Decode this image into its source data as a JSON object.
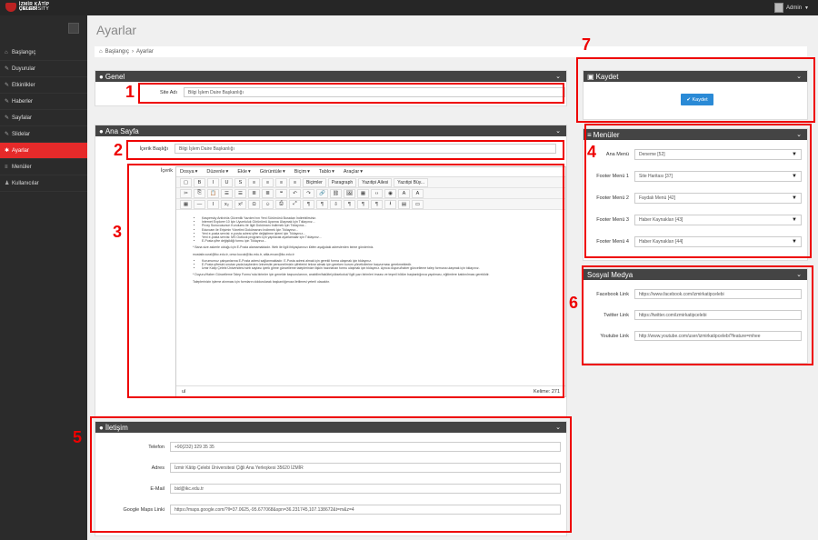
{
  "brand": {
    "line1": "İZMİR KÂTİP ÇELEBİ",
    "line2": "UNIVERSITY"
  },
  "user": {
    "name": "Admin"
  },
  "sidebar": {
    "items": [
      {
        "icon": "home-icon",
        "label": "Başlangıç"
      },
      {
        "icon": "edit-icon",
        "label": "Duyurular"
      },
      {
        "icon": "edit-icon",
        "label": "Etkinlikler"
      },
      {
        "icon": "edit-icon",
        "label": "Haberler"
      },
      {
        "icon": "edit-icon",
        "label": "Sayfalar"
      },
      {
        "icon": "edit-icon",
        "label": "Slidelar"
      },
      {
        "icon": "gear-icon",
        "label": "Ayarlar"
      },
      {
        "icon": "list-icon",
        "label": "Menüler"
      },
      {
        "icon": "user-icon",
        "label": "Kullanıcılar"
      }
    ],
    "active_index": 6
  },
  "page": {
    "title": "Ayarlar",
    "breadcrumb": [
      "Başlangıç",
      "Ayarlar"
    ]
  },
  "genel": {
    "title": "Genel",
    "site_adi_label": "Site Adı",
    "site_adi_value": "Bilgi İşlem Daire Başkanlığı"
  },
  "ana_sayfa": {
    "title": "Ana Sayfa",
    "icerik_basligi_label": "İçerik Başlığı",
    "icerik_basligi_value": "Bilgi İşlem Daire Başkanlığı",
    "icerik_label": "İçerik",
    "editor": {
      "menus": [
        "Dosya",
        "Düzenle",
        "Ekle",
        "Görüntüle",
        "Biçim",
        "Tablo",
        "Araçlar"
      ],
      "toolbar1": [
        "▢",
        "B",
        "I",
        "U",
        "S",
        "≡",
        "≡",
        "≡",
        "≡"
      ],
      "dropdowns1": [
        "Biçimler",
        "Paragraph",
        "Yazıtipi Ailesi",
        "Yazıtipi Büy..."
      ],
      "toolbar2": [
        "✂",
        "⎘",
        "📋",
        "☰",
        "☰",
        "≣",
        "≣",
        "❝",
        "↶",
        "↷",
        "🔗",
        "⛓",
        "🖼",
        "▦",
        "‹›",
        "◉",
        "A",
        "A"
      ],
      "toolbar3": [
        "▦",
        "—",
        "Ⅰ",
        "x₂",
        "x²",
        "Ω",
        "☺",
        "⎙",
        "⤢",
        "¶",
        "¶",
        "⇩",
        "¶",
        "¶",
        "¶",
        "⭳",
        "▤",
        "▭"
      ],
      "body": {
        "list1": [
          "Kaspersky Antivirüs Güvenlik Yazılımı'nın Yeni Sürümünü Buradan İndirebilirsiniz.",
          "İnternet Explorer 10 İçin Uyumluluk Görünümü Ayarına Ulaşmak İçin Tıklayınız...",
          "Proxy Sunucusunun Kurulumu ile İlgili Dokümanı İndirmek İçin Tıklayınız...",
          "Eduroam ile Erişimin Yönetimi Dokümanını İndirmek İçin Tıklayınız...",
          "Yeni e-posta servisi: e-posta adresi şifre değiştirme işlemi için Tıklayınız...",
          "Yeni e-posta servisi: MS Outlook programı için yapılacak ayarlamalar için Tıklayınız...",
          "E-Posta şifre değişikliği formu için Tıklayınız..."
        ],
        "para1": "* Bana size askerle olduğu için E-Posta alamamaktadır. Web ile ilgili ihtiyaçlarınızı lütfen aşağıdaki adreslerden birine gönderiniz.",
        "para2": "mustafa.vural@ikc.edu.tr, omur.kucuk@ikc.edu.tr, atila.ercan@ikc.edu.tr",
        "list2": [
          "Kurumumuz çalışanlarına E-Posta adresi sağlanmaktadır. E-Posta adresi almak için gerekli forma ulaşmak için tıklayınız.",
          "E-Posta şifresini unutan yada kaybeden üniversite personelimizin şifrelerini tekrar almak için gereken kurum yöneticilerine başvurması gerekmektedir.",
          "İzmir Kâtip Çelebi Üniversitesi web sayfası içerik girme güncelleme taleplerinize ilişkin hazırlanan formu ulaşmak için tıklayınız. Ayrıca duyuru/haber güncelleme talep formuna ulaşmak için tıklayınız."
        ],
        "para3": "* Duyuru/Haber Güncelleme Talep Formu'nda birimler için genelde başvurularının, anabilim/fakülte/yüksekokul/ ilgili yazı birimleri imzası ve teşmil bölüm başkanlığınca yapılması, eğitimlere katılınılması gereklidir.",
        "para4": "Taleplerinizin işleme alınması için formların doldurularak başkanlığımıza iletilmesi yeterli olacaktır."
      },
      "path": "ul",
      "word_count": "Kelime: 271"
    }
  },
  "iletisim": {
    "title": "İletişim",
    "fields": [
      {
        "label": "Telefon",
        "value": "+90(232) 329 35 35"
      },
      {
        "label": "Adres",
        "value": "İzmir Kâtip Çelebi Üniversitesi Çiğli Ana Yerleşkesi 35620 İZMİR"
      },
      {
        "label": "E-Mail",
        "value": "bid@ikc.edu.tr"
      },
      {
        "label": "Google Maps Linki",
        "value": "https://maps.google.com/?ll=37.0625,-95.677068&spn=36.231745,107.138672&t=m&z=4"
      }
    ]
  },
  "kaydet": {
    "title": "Kaydet",
    "button": "Kaydet"
  },
  "menuler": {
    "title": "Menüler",
    "fields": [
      {
        "label": "Ana Menü",
        "value": "Deneme [52]"
      },
      {
        "label": "Footer Menü 1",
        "value": "Site Haritası [37]"
      },
      {
        "label": "Footer Menü 2",
        "value": "Faydalı Menü [42]"
      },
      {
        "label": "Footer Menü 3",
        "value": "Haber Kaynakları [43]"
      },
      {
        "label": "Footer Menü 4",
        "value": "Haber Kaynakları [44]"
      }
    ]
  },
  "sosyal": {
    "title": "Sosyal Medya",
    "fields": [
      {
        "label": "Facebook Link",
        "value": "https://www.facebook.com/izmirkatipcelebi"
      },
      {
        "label": "Twitter Link",
        "value": "https://twitter.com/izmirkatipcelebi"
      },
      {
        "label": "Youtube Link",
        "value": "http://www.youtube.com/user/izmirkatipcelebi?feature=mhee"
      }
    ]
  },
  "annotations": [
    "1",
    "2",
    "3",
    "4",
    "5",
    "6",
    "7"
  ]
}
